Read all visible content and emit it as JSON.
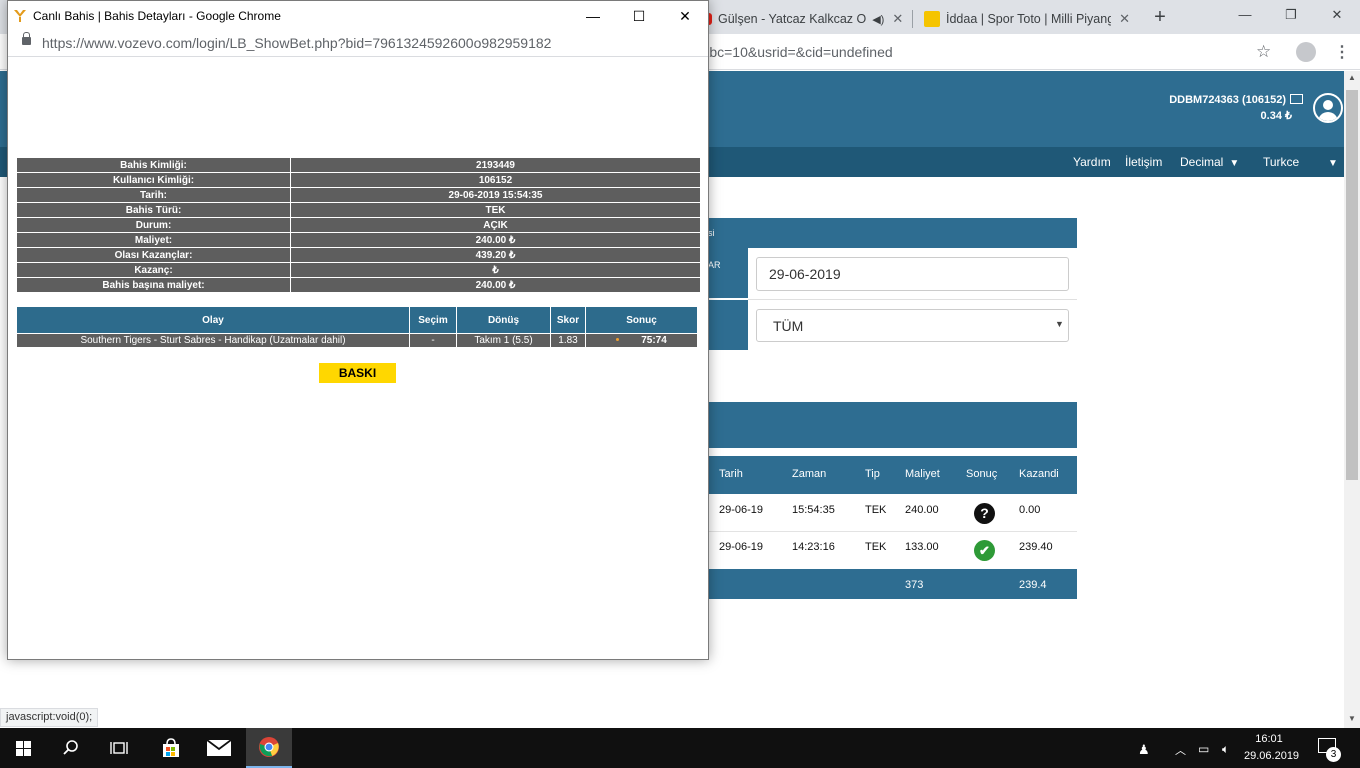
{
  "bg_browser": {
    "tabs": [
      {
        "title": "Gülşen - Yatcaz Kalkcaz O",
        "audio_icon": "speaker-icon"
      },
      {
        "title": "İddaa | Spor Toto | Milli Piyango"
      }
    ],
    "url_tail": "&bc=10&usrid=&cid=undefined"
  },
  "site": {
    "user_id": "DDBM724363 (106152)",
    "balance": "0.34 ₺",
    "nav": {
      "help": "Yardım",
      "contact": "İletişim",
      "odds": "Decimal",
      "lang": "Turkce"
    },
    "form": {
      "head_fragment": "si",
      "label_fragment": "AR",
      "date_value": "29-06-2019",
      "select_value": "TÜM"
    },
    "list": {
      "columns": [
        "Tarih",
        "Zaman",
        "Tip",
        "Maliyet",
        "Sonuç",
        "Kazandi"
      ],
      "rows": [
        {
          "tarih": "29-06-19",
          "zaman": "15:54:35",
          "tip": "TEK",
          "maliyet": "240.00",
          "sonuc": "?",
          "kazandi": "0.00"
        },
        {
          "tarih": "29-06-19",
          "zaman": "14:23:16",
          "tip": "TEK",
          "maliyet": "133.00",
          "sonuc": "✔",
          "kazandi": "239.40"
        }
      ],
      "total_cost": "373",
      "total_won": "239.4"
    }
  },
  "popup": {
    "window_title": "Canlı Bahis | Bahis Detayları - Google Chrome",
    "url": "https://www.vozevo.com/login/LB_ShowBet.php?bid=7961324592600o982959182",
    "details": [
      {
        "label": "Bahis Kimliği:",
        "value": "2193449"
      },
      {
        "label": "Kullanıcı Kimliği:",
        "value": "106152"
      },
      {
        "label": "Tarih:",
        "value": "29-06-2019 15:54:35"
      },
      {
        "label": "Bahis Türü:",
        "value": "TEK"
      },
      {
        "label": "Durum:",
        "value": "AÇIK"
      },
      {
        "label": "Maliyet:",
        "value": "240.00 ₺"
      },
      {
        "label": "Olası Kazançlar:",
        "value": "439.20 ₺"
      },
      {
        "label": "Kazanç:",
        "value": "₺"
      },
      {
        "label": "Bahis başına maliyet:",
        "value": "240.00 ₺"
      }
    ],
    "events_header": {
      "olay": "Olay",
      "secim": "Seçim",
      "donus": "Dönüş",
      "skor": "Skor",
      "sonuc": "Sonuç"
    },
    "events": [
      {
        "olay": "Southern Tigers - Sturt Sabres - Handikap (Uzatmalar dahil)",
        "secim": "-",
        "donus": "Takım 1 (5.5)",
        "skor": "1.83",
        "sonuc": "75:74"
      }
    ],
    "print_label": "BASKI"
  },
  "status_bar": "javascript:void(0);",
  "taskbar": {
    "time": "16:01",
    "date": "29.06.2019",
    "notifications": "3"
  }
}
